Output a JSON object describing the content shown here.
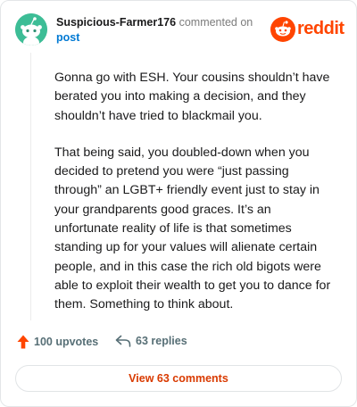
{
  "header": {
    "username": "Suspicious-Farmer176",
    "action_text": "commented on",
    "post_link": "post",
    "logo_text": "reddit",
    "avatar_icon": "snoo-avatar-icon",
    "logo_icon": "reddit-snoo-icon"
  },
  "comment": {
    "paragraphs": [
      "Gonna go with ESH. Your cousins shouldn’t have berated you into making a decision, and they shouldn’t have tried to blackmail you.",
      "That being said, you doubled-down when you decided to pretend you were “just passing through” an LGBT+ friendly event just to stay in your grandparents good graces. It’s an unfortunate reality of life is that sometimes standing up for your values will alienate certain people, and in this case the rich old bigots were able to exploit their wealth to get you to dance for them. Something to think about."
    ]
  },
  "actions": {
    "upvotes": "100 upvotes",
    "replies": "63 replies",
    "upvote_icon": "upvote-arrow-icon",
    "reply_icon": "reply-arrow-icon"
  },
  "footer": {
    "view_comments": "View 63 comments"
  },
  "colors": {
    "brand": "#ff4500",
    "avatar_bg": "#3dbd96",
    "link": "#0079d3",
    "view_button_text": "#d93a00",
    "meta_text": "#7c7c7c"
  }
}
